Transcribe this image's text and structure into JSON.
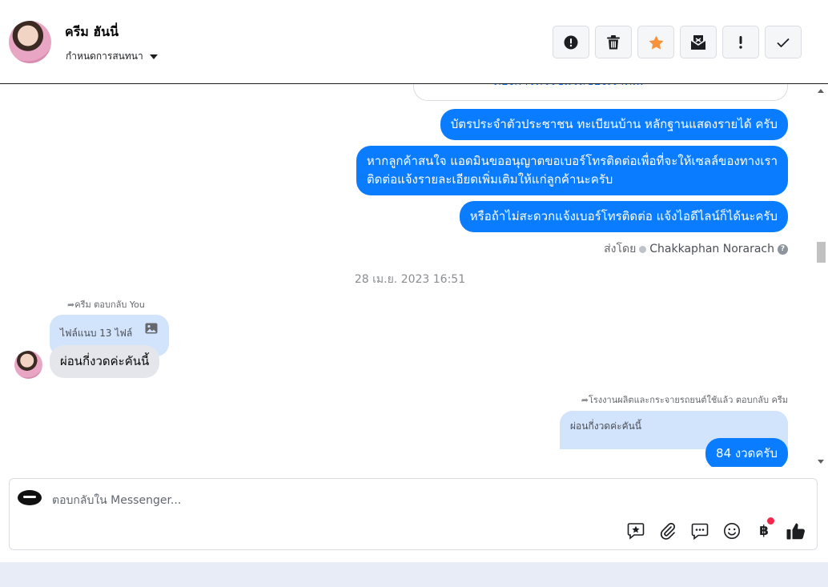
{
  "header": {
    "contact_name": "ครีม ฮันนี่",
    "conversation_settings": "กำหนดการสนทนา",
    "toolbar": [
      {
        "name": "spam-button",
        "icon": "alert-circle-icon"
      },
      {
        "name": "delete-button",
        "icon": "trash-icon"
      },
      {
        "name": "star-button",
        "icon": "star-icon",
        "color": "#f7923b"
      },
      {
        "name": "archive-button",
        "icon": "mail-archive-icon"
      },
      {
        "name": "important-button",
        "icon": "exclamation-icon"
      },
      {
        "name": "done-button",
        "icon": "check-icon"
      }
    ]
  },
  "chat": {
    "card_partial_text": "ต้องการทัวร์ชมรถของเราค...",
    "outgoing": [
      "บัตรประจำตัวประชาชน ทะเบียนบ้าน หลักฐานแสดงรายได้ ครับ",
      "หากลูกค้าสนใจ แอดมินขออนุญาตขอเบอร์โทรติดต่อเพื่อที่จะให้เซลล์ของทางเรา\nติดต่อแจ้งรายละเอียดเพิ่มเติมให้แก่ลูกค้านะครับ",
      "หรือถ้าไม่สะดวกแจ้งเบอร์โทรติดต่อ แจ้งไอดีไลน์ก็ได้นะครับ"
    ],
    "sent_by_label": "ส่งโดย",
    "sent_by_agent": "Chakkaphan Norarach",
    "timestamp": "28 เม.ย. 2023 16:51",
    "incoming_reply_note": "ครีม ตอบกลับ You",
    "incoming_quoted": "ไฟล์แนบ 13 ไฟล์",
    "incoming_message": "ผ่อนกี่งวดค่ะคันนี้",
    "outgoing_reply_note": "โรงงานผลิตและกระจายรถยนต์ใช้แล้ว ตอบกลับ ครีม",
    "outgoing_quoted": "ผ่อนกี่งวดค่ะคันนี้",
    "outgoing_last": "84 งวดครับ"
  },
  "composer": {
    "placeholder": "ตอบกลับใน Messenger...",
    "value": "",
    "tools": [
      "saved-reply-icon",
      "attachment-icon",
      "quick-reply-icon",
      "emoji-icon",
      "baht-payment-icon",
      "like-icon"
    ],
    "baht_symbol": "฿"
  },
  "colors": {
    "accent": "#0a7cff",
    "link": "#1877f2",
    "notification": "#f02849"
  }
}
